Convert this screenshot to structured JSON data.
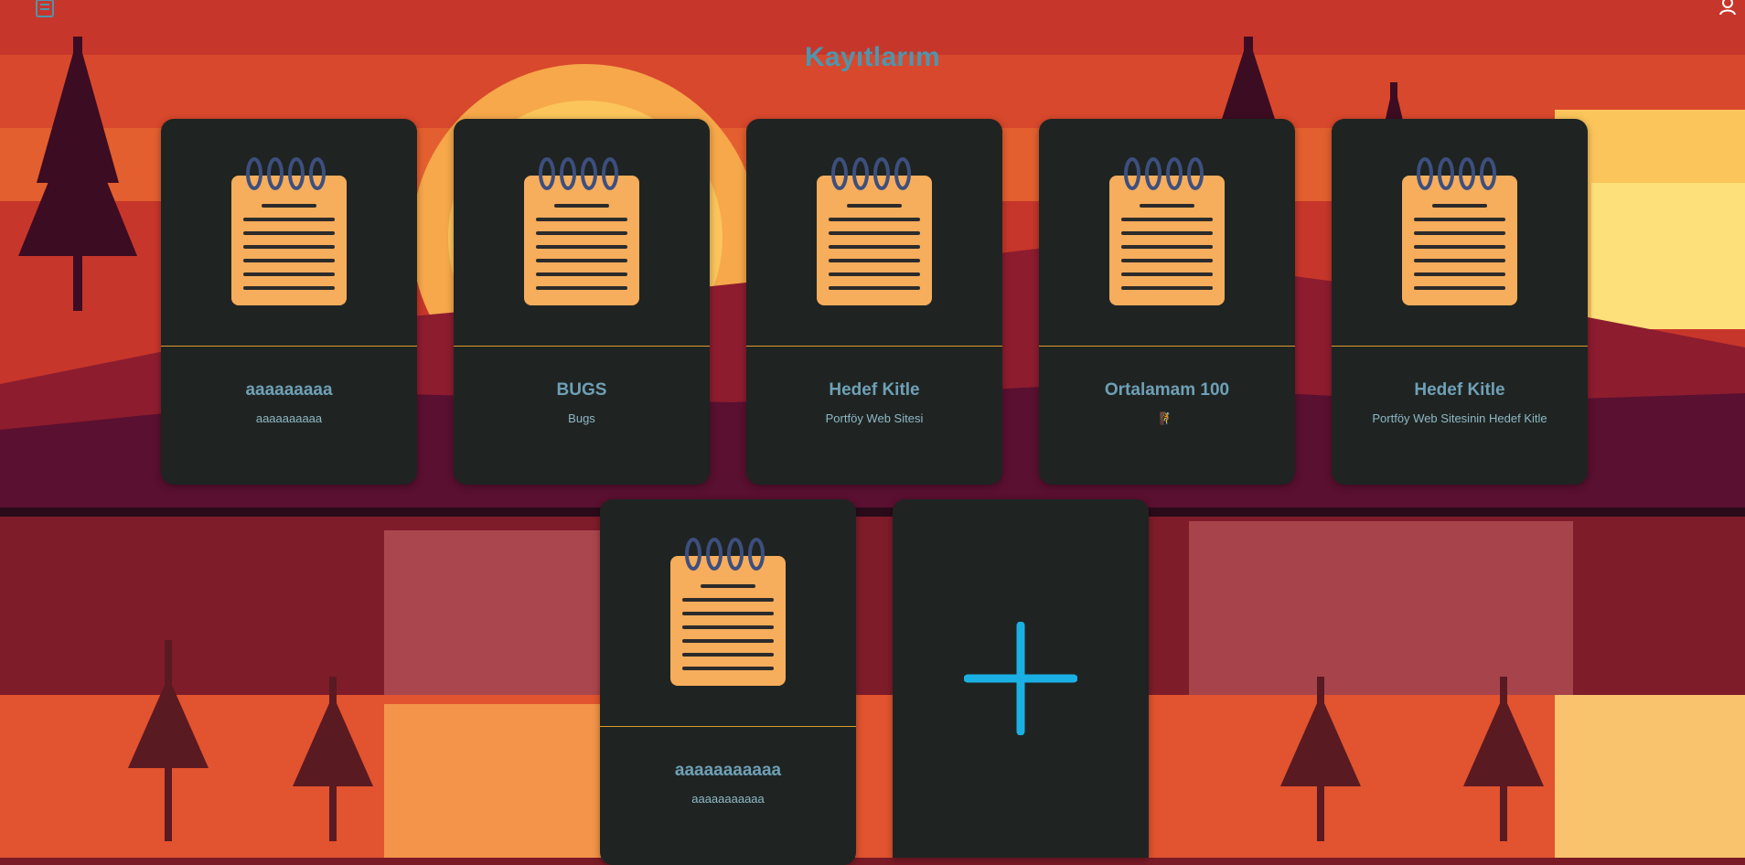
{
  "header": {
    "title": "Kayıtlarım"
  },
  "notes": [
    {
      "title": "aaaaaaaaa",
      "description": "aaaaaaaaaa"
    },
    {
      "title": "BUGS",
      "description": "Bugs"
    },
    {
      "title": "Hedef Kitle",
      "description": "Portföy Web Sitesi"
    },
    {
      "title": "Ortalamam 100",
      "description": "🧗"
    },
    {
      "title": "Hedef Kitle",
      "description": "Portföy Web Sitesinin Hedef Kitle"
    },
    {
      "title": "aaaaaaaaaaa",
      "description": "aaaaaaaaaaa"
    }
  ],
  "icons": {
    "top_left": "notes-icon",
    "top_right": "user-icon",
    "note_image": "notepad-icon",
    "add": "plus-icon"
  },
  "colors": {
    "title": "#4f95ad",
    "card_bg": "#1f2422",
    "card_divider": "#d99a2b",
    "note_title": "#6fa0b6",
    "add_plus": "#1ab0e4"
  }
}
